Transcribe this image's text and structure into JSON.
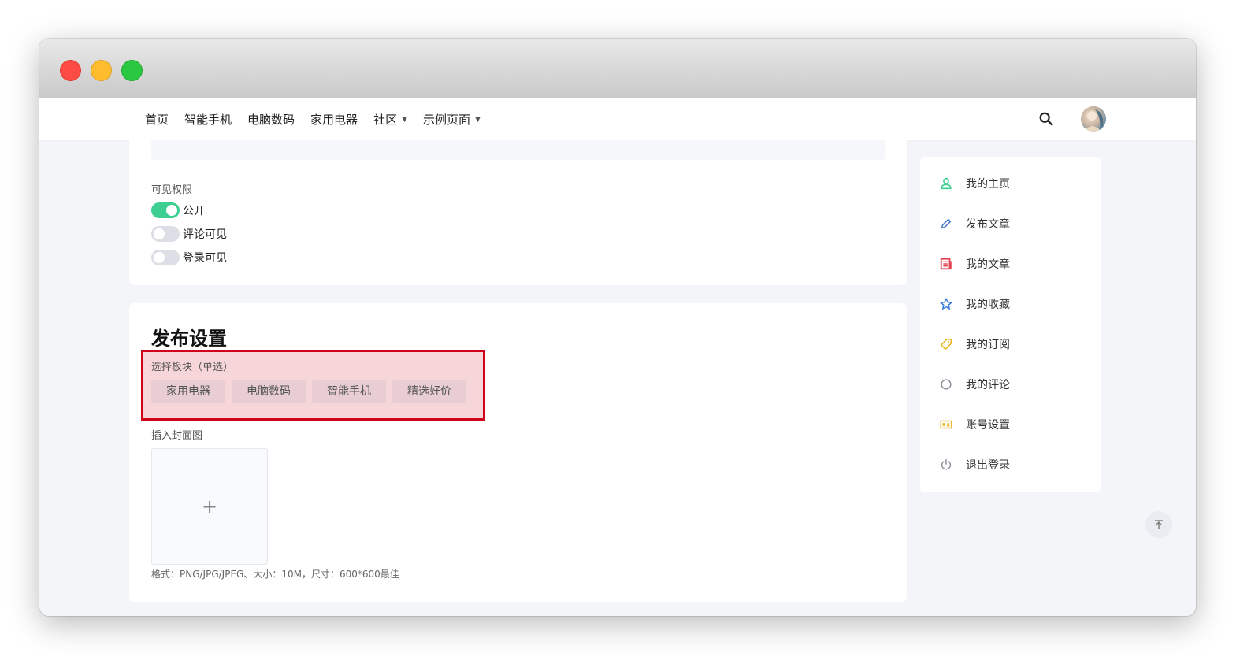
{
  "window": {
    "controls": [
      "close",
      "minimize",
      "maximize"
    ]
  },
  "nav": {
    "items": [
      {
        "label": "首页",
        "dropdown": false
      },
      {
        "label": "智能手机",
        "dropdown": false
      },
      {
        "label": "电脑数码",
        "dropdown": false
      },
      {
        "label": "家用电器",
        "dropdown": false
      },
      {
        "label": "社区",
        "dropdown": true
      },
      {
        "label": "示例页面",
        "dropdown": true
      }
    ],
    "caret": "▼",
    "search_icon": "search-icon",
    "avatar_icon": "user-avatar"
  },
  "visibility": {
    "label": "可见权限",
    "options": [
      {
        "label": "公开",
        "on": true
      },
      {
        "label": "评论可见",
        "on": false
      },
      {
        "label": "登录可见",
        "on": false
      }
    ],
    "on_color": "#3ccf91",
    "off_color": "#dcdfe6"
  },
  "publish": {
    "title": "发布设置",
    "board_label": "选择板块（单选）",
    "boards": [
      "家用电器",
      "电脑数码",
      "智能手机",
      "精选好价"
    ],
    "cover_label": "插入封面图",
    "upload_symbol": "+",
    "hint": "格式：PNG/JPG/JPEG、大小：10M，尺寸：600*600最佳",
    "highlight_color": "#d0021b"
  },
  "sidebar": {
    "items": [
      {
        "label": "我的主页",
        "icon": "user-icon",
        "color": "#3ccf91"
      },
      {
        "label": "发布文章",
        "icon": "pencil-icon",
        "color": "#4a7bd0"
      },
      {
        "label": "我的文章",
        "icon": "document-icon",
        "color": "#e0424f"
      },
      {
        "label": "我的收藏",
        "icon": "star-icon",
        "color": "#3a78d8"
      },
      {
        "label": "我的订阅",
        "icon": "tag-icon",
        "color": "#e8b520"
      },
      {
        "label": "我的评论",
        "icon": "comment-icon",
        "color": "#8a8f98"
      },
      {
        "label": "账号设置",
        "icon": "id-card-icon",
        "color": "#e8b520"
      },
      {
        "label": "退出登录",
        "icon": "power-icon",
        "color": "#8a8f98"
      }
    ]
  },
  "backtop": {
    "icon": "back-to-top-icon"
  }
}
